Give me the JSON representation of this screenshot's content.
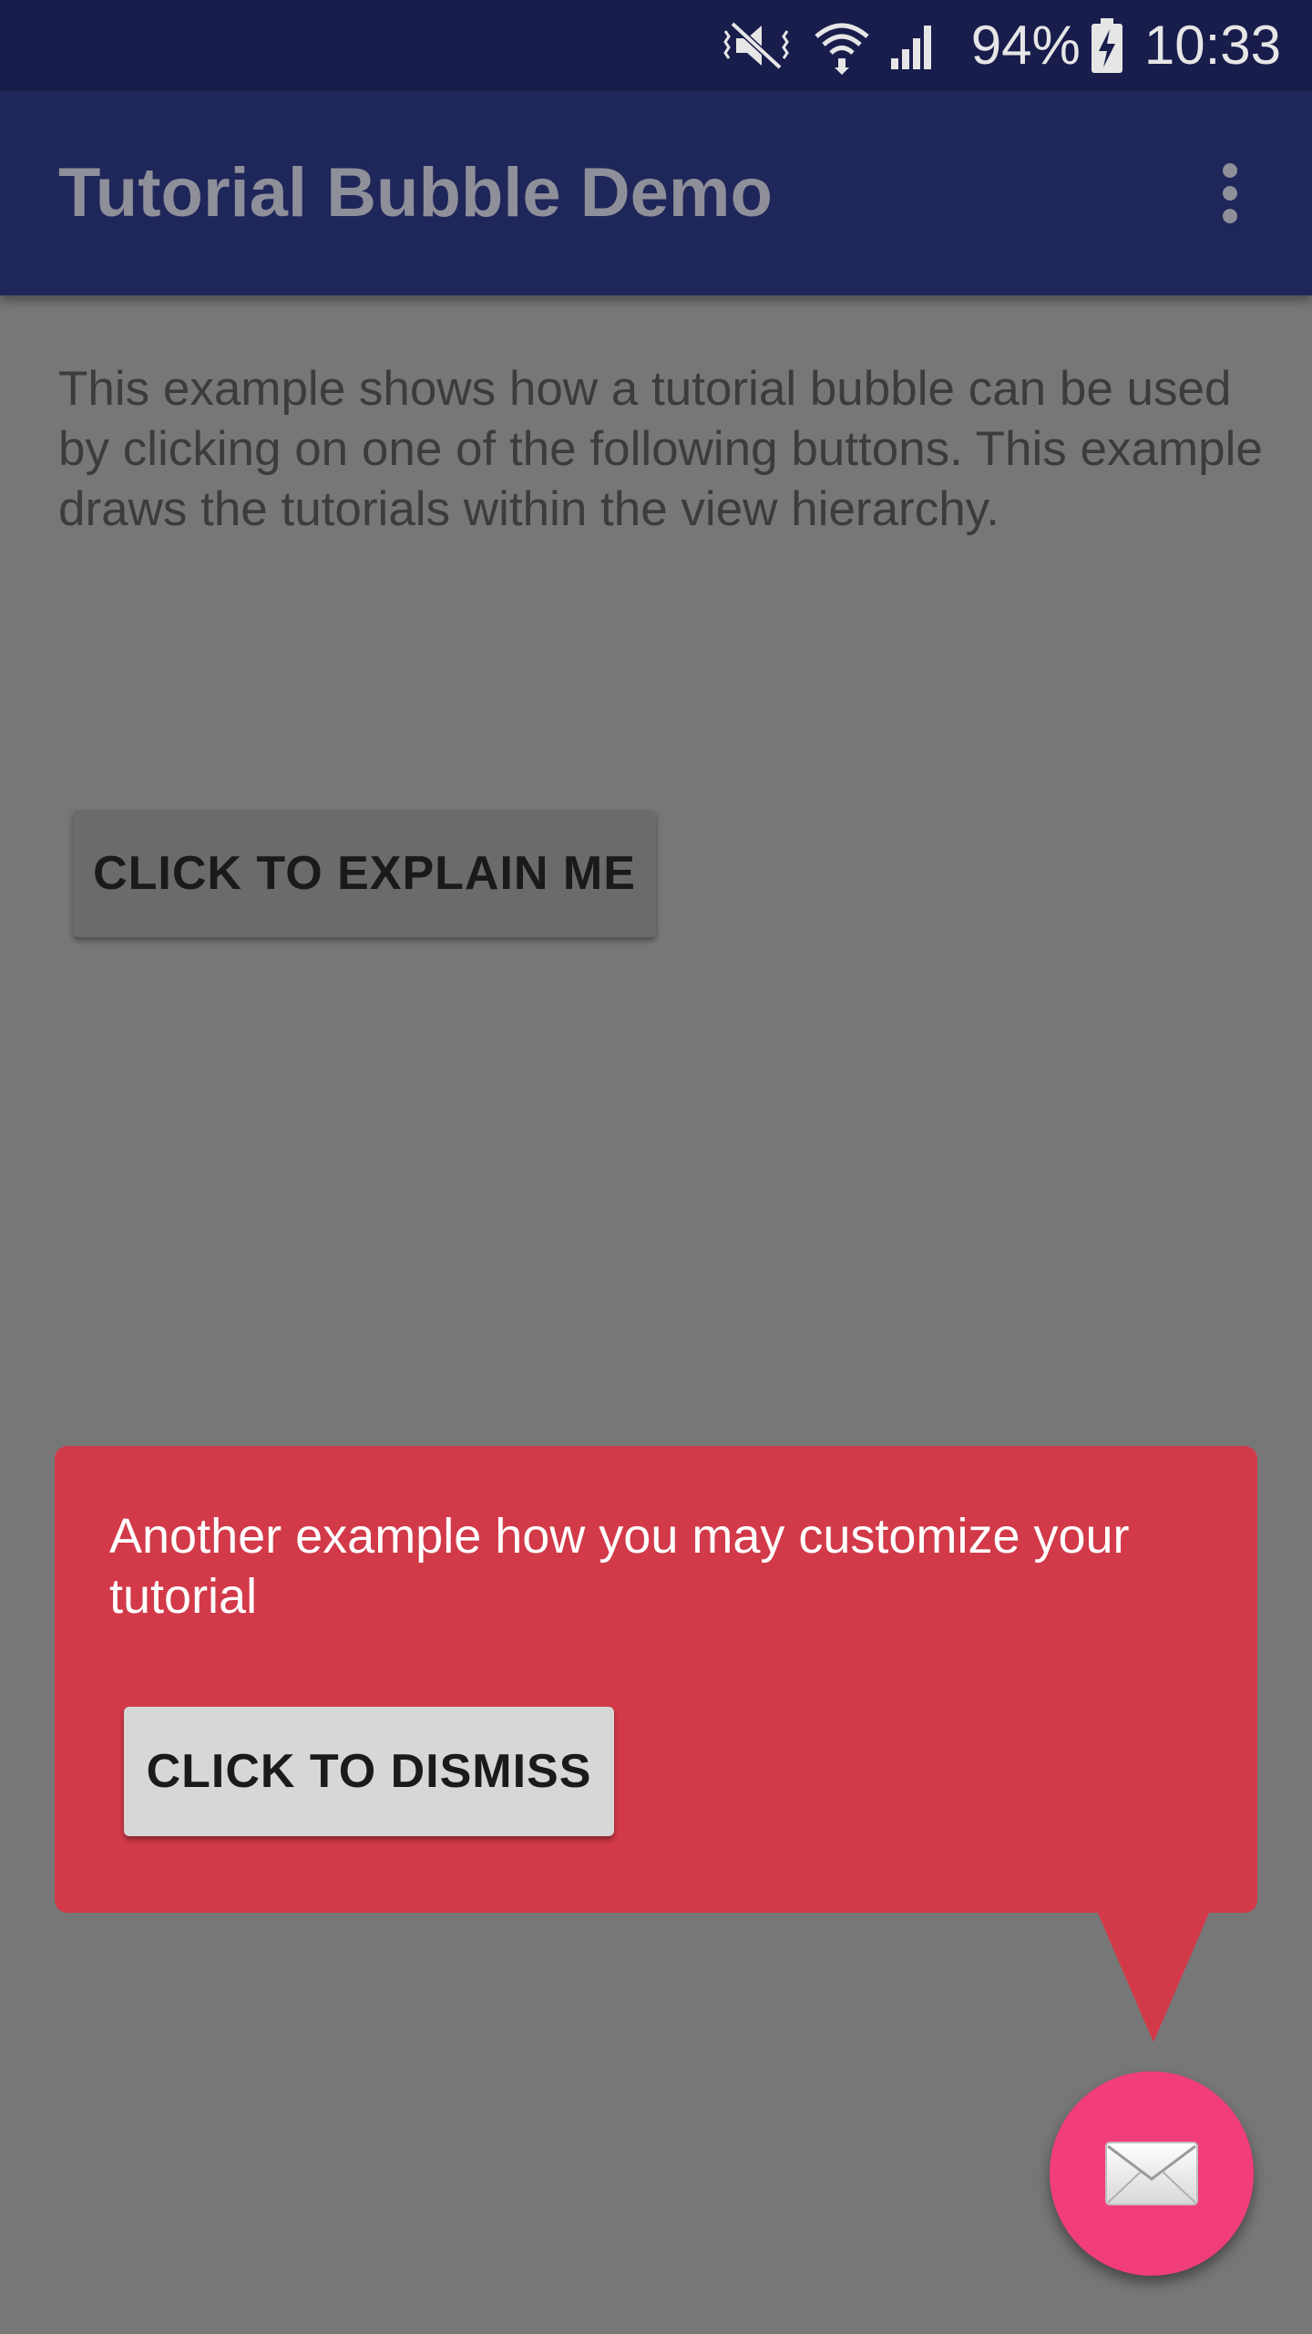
{
  "status_bar": {
    "battery_percent": "94%",
    "time": "10:33",
    "icons": [
      "vibrate-mute-icon",
      "wifi-icon",
      "signal-icon",
      "battery-charging-icon"
    ]
  },
  "app_bar": {
    "title": "Tutorial Bubble Demo",
    "menu_icon": "overflow-menu-icon"
  },
  "content": {
    "intro_text": "This example shows how a tutorial bubble can be used by clicking on one of the following buttons. This example draws the tutorials within the view hierarchy.",
    "explain_button_label": "CLICK TO EXPLAIN ME"
  },
  "tutorial_bubble": {
    "message": "Another example how you may customize your tutorial",
    "dismiss_button_label": "CLICK TO DISMISS"
  },
  "fab": {
    "icon": "envelope-icon"
  },
  "colors": {
    "status_bar": "#181d4c",
    "app_bar": "#1f265a",
    "overlay_background": "#777777",
    "bubble": "#d23a49",
    "fab": "#f23d7b"
  }
}
